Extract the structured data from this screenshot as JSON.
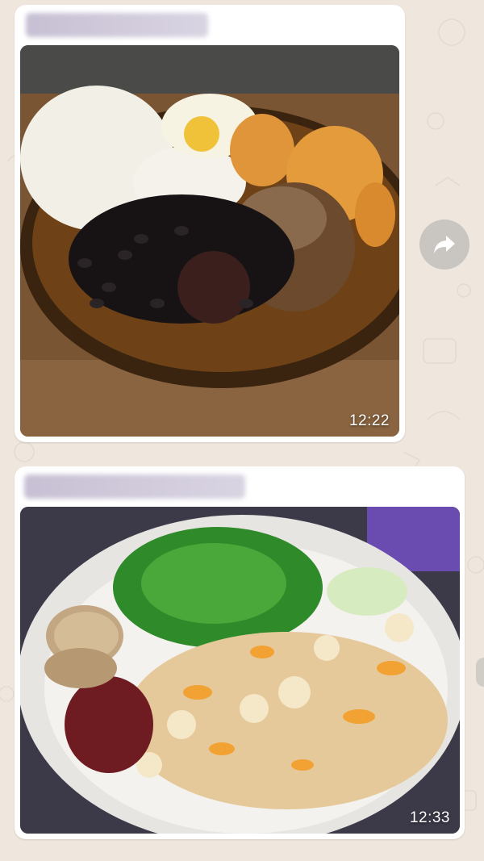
{
  "messages": [
    {
      "sender": "",
      "time": "12:22",
      "photo_icon": "plated-meal-photo-black-beans-rice-pork"
    },
    {
      "sender": "",
      "time": "12:33",
      "photo_icon": "plated-meal-photo-salad-rice-beans"
    }
  ],
  "forward_icon": "forward-arrow-icon",
  "colors": {
    "chat_background": "#efe7dd",
    "bubble": "#ffffff",
    "forward_button": "#aaaaaa"
  }
}
